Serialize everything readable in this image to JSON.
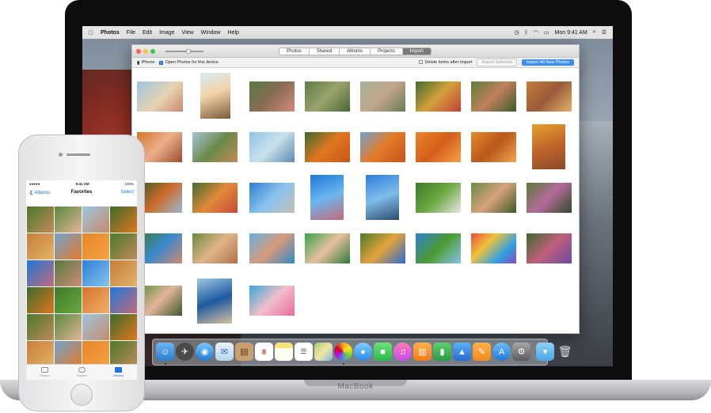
{
  "menubar": {
    "apple": "",
    "app_name": "Photos",
    "items": [
      "File",
      "Edit",
      "Image",
      "View",
      "Window",
      "Help"
    ],
    "clock": "Mon 9:41 AM"
  },
  "window": {
    "tabs": [
      {
        "label": "Photos",
        "active": false
      },
      {
        "label": "Shared",
        "active": false
      },
      {
        "label": "Albums",
        "active": false
      },
      {
        "label": "Projects",
        "active": false
      },
      {
        "label": "Import",
        "active": true
      }
    ],
    "device_label": "iPhone",
    "open_photos_label": "Open Photos for this device",
    "delete_label": "Delete items after import",
    "import_selected_label": "Import Selected",
    "import_all_label": "Import All New Photos"
  },
  "laptop": {
    "brand": "MacBook"
  },
  "phone": {
    "status_left": "●●●●● ",
    "status_time": "9:41 AM",
    "status_right": "100%",
    "nav_back": "❮ Albums",
    "nav_title": "Favorites",
    "nav_select": "Select",
    "tabs": [
      {
        "label": "Photos",
        "active": false
      },
      {
        "label": "Shared",
        "active": false
      },
      {
        "label": "Albums",
        "active": true
      }
    ]
  },
  "colors": {
    "accent": "#3b8df5",
    "ios_tint": "#1a73e8"
  },
  "dock_icons": [
    "finder-icon",
    "launchpad-icon",
    "safari-icon",
    "mail-icon",
    "contacts-icon",
    "calendar-icon",
    "notes-icon",
    "reminders-icon",
    "maps-icon",
    "photos-icon",
    "messages-icon",
    "facetime-icon",
    "itunes-icon",
    "ibooks-icon",
    "numbers-icon",
    "keynote-icon",
    "pages-icon",
    "app-store-icon",
    "system-preferences-icon",
    "downloads-icon",
    "trash-icon"
  ]
}
